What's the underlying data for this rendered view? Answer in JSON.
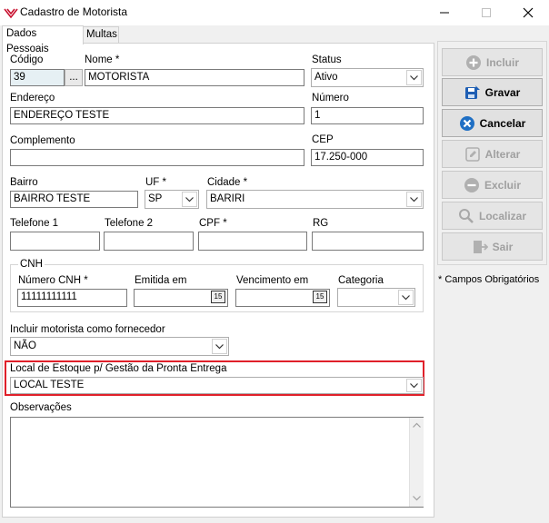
{
  "window": {
    "title": "Cadastro de Motorista"
  },
  "tabs": [
    {
      "label": "Dados Pessoais"
    },
    {
      "label": "Multas"
    }
  ],
  "form": {
    "codigo": {
      "label": "Código",
      "value": "39",
      "lookup": "..."
    },
    "nome": {
      "label": "Nome *",
      "value": "MOTORISTA"
    },
    "status": {
      "label": "Status",
      "value": "Ativo"
    },
    "endereco": {
      "label": "Endereço",
      "value": "ENDEREÇO TESTE"
    },
    "numero": {
      "label": "Número",
      "value": "1"
    },
    "complemento": {
      "label": "Complemento",
      "value": ""
    },
    "cep": {
      "label": "CEP",
      "value": "17.250-000"
    },
    "bairro": {
      "label": "Bairro",
      "value": "BAIRRO TESTE"
    },
    "uf": {
      "label": "UF *",
      "value": "SP"
    },
    "cidade": {
      "label": "Cidade *",
      "value": "BARIRI"
    },
    "telefone1": {
      "label": "Telefone 1",
      "value": ""
    },
    "telefone2": {
      "label": "Telefone 2",
      "value": ""
    },
    "cpf": {
      "label": "CPF *",
      "value": ""
    },
    "rg": {
      "label": "RG",
      "value": ""
    },
    "cnh_group": {
      "label": "CNH"
    },
    "numero_cnh": {
      "label": "Número CNH *",
      "value": "11111111111"
    },
    "emitida_em": {
      "label": "Emitida em",
      "value": " / /",
      "cal": "15"
    },
    "vencimento_em": {
      "label": "Vencimento em",
      "value": " / /",
      "cal": "15"
    },
    "categoria": {
      "label": "Categoria",
      "value": ""
    },
    "incluir_fornecedor": {
      "label": "Incluir motorista como fornecedor",
      "value": "NÃO"
    },
    "local_estoque": {
      "label": "Local de Estoque p/ Gestão da Pronta Entrega",
      "value": "LOCAL TESTE"
    },
    "observacoes": {
      "label": "Observações",
      "value": ""
    }
  },
  "actions": {
    "incluir": "Incluir",
    "gravar": "Gravar",
    "cancelar": "Cancelar",
    "alterar": "Alterar",
    "excluir": "Excluir",
    "localizar": "Localizar",
    "sair": "Sair"
  },
  "note": "* Campos Obrigatórios",
  "colors": {
    "highlight": "#e0202a",
    "cancel_icon": "#1f6fc4",
    "gravar_icon": "#1f5fb4",
    "app_icon": "#c8102e"
  }
}
